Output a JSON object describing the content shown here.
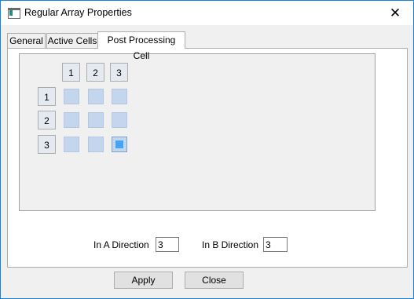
{
  "window": {
    "title": "Regular Array Properties",
    "close_glyph": "✕",
    "icon": "app-window-icon",
    "border_color": "#1883d7"
  },
  "tabs": [
    {
      "label": "General",
      "active": false
    },
    {
      "label": "Active Cells",
      "active": false
    },
    {
      "label": "Post Processing Cell",
      "active": true
    }
  ],
  "grid": {
    "column_headers": [
      "1",
      "2",
      "3"
    ],
    "row_headers": [
      "1",
      "2",
      "3"
    ],
    "selected_cell": {
      "row": 3,
      "column": 3
    },
    "cell_color": "#c4d6ee",
    "selected_color": "#3fa3f7"
  },
  "fields": {
    "a_direction": {
      "label": "In A Direction",
      "value": "3"
    },
    "b_direction": {
      "label": "In B Direction",
      "value": "3"
    }
  },
  "buttons": {
    "apply": "Apply",
    "close": "Close"
  }
}
